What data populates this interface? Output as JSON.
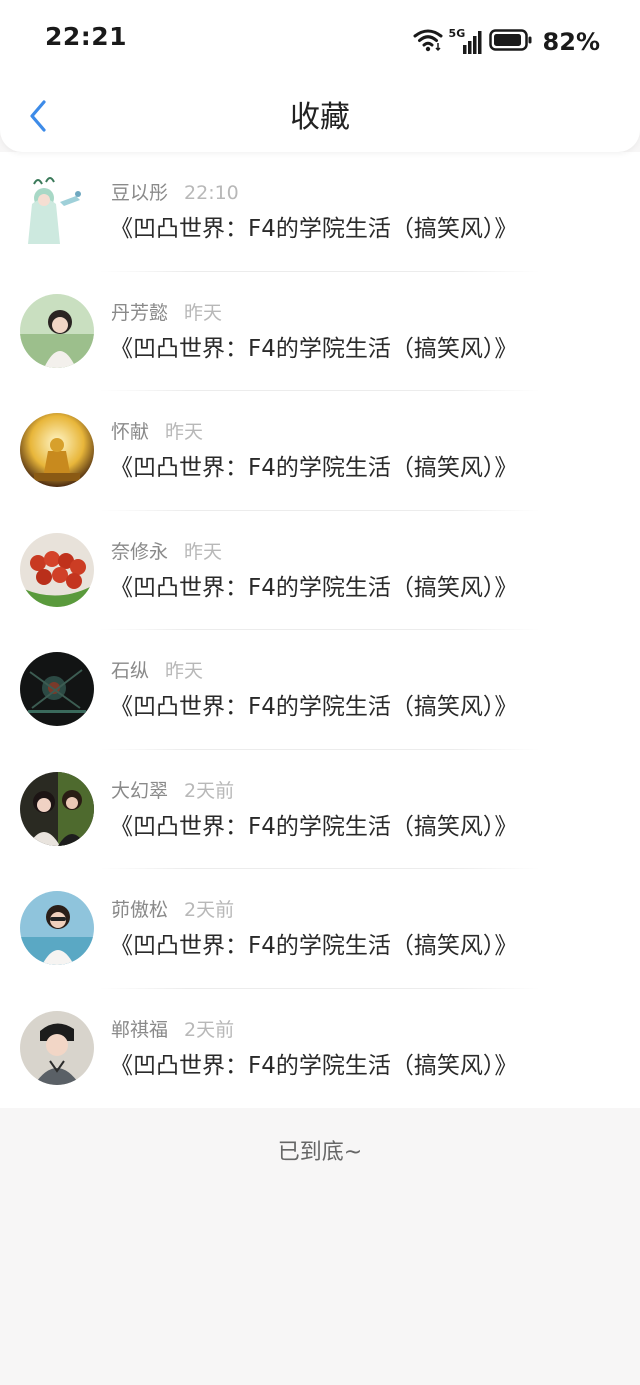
{
  "status_bar": {
    "time": "22:21",
    "network": "5G",
    "battery": "82%"
  },
  "header": {
    "title": "收藏",
    "back_icon": "chevron-left-icon"
  },
  "colors": {
    "accent": "#3d8be8",
    "name_text": "#8a8a8a",
    "time_text": "#b8b8b8",
    "title_text": "#2a2a2a"
  },
  "favorites": [
    {
      "user": "豆以彤",
      "time": "22:10",
      "title": "《凹凸世界：F4的学院生活（搞笑风）》"
    },
    {
      "user": "丹芳懿",
      "time": "昨天",
      "title": "《凹凸世界：F4的学院生活（搞笑风）》"
    },
    {
      "user": "怀献",
      "time": "昨天",
      "title": "《凹凸世界：F4的学院生活（搞笑风）》"
    },
    {
      "user": "奈修永",
      "time": "昨天",
      "title": "《凹凸世界：F4的学院生活（搞笑风）》"
    },
    {
      "user": "石纵",
      "time": "昨天",
      "title": "《凹凸世界：F4的学院生活（搞笑风）》"
    },
    {
      "user": "大幻翠",
      "time": "2天前",
      "title": "《凹凸世界：F4的学院生活（搞笑风）》"
    },
    {
      "user": "茆傲松",
      "time": "2天前",
      "title": "《凹凸世界：F4的学院生活（搞笑风）》"
    },
    {
      "user": "郸祺福",
      "time": "2天前",
      "title": "《凹凸世界：F4的学院生活（搞笑风）》"
    }
  ],
  "footer": {
    "end_text": "已到底~"
  }
}
